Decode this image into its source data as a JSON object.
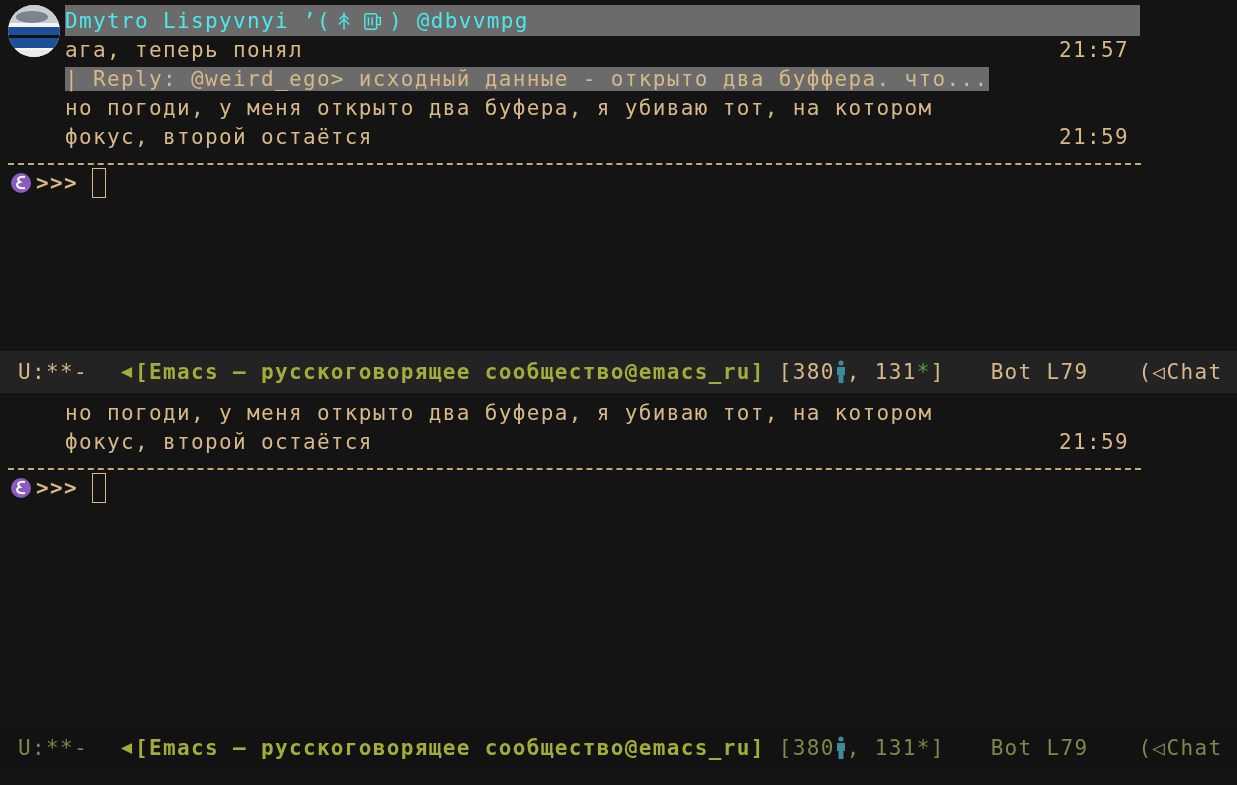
{
  "windows": [
    {
      "active": true,
      "entries": [
        {
          "kind": "author",
          "name": "Dmytro Lispyvnyi ’(",
          "handle": ") @dbvvmpg"
        },
        {
          "kind": "message",
          "lines": [
            "ага, теперь понял"
          ],
          "time": "21:57"
        },
        {
          "kind": "reply",
          "text": "| Reply: @weird_ego> исходный данные - открыто два буффера. что..."
        },
        {
          "kind": "message",
          "lines": [
            "но погоди, у меня открыто два буфера, я убиваю тот, на котором",
            "фокус, второй остаётся"
          ],
          "time": "21:59"
        }
      ],
      "prompt": ">>>",
      "mode_line": {
        "state": "U:**-",
        "buffer": "[Emacs – русскоговорящее сообщество@emacs_ru]",
        "members": "[380",
        "unread": ", 131",
        "star": "*",
        "close": "]",
        "position": "Bot L79",
        "mode": "(◁Chat"
      }
    },
    {
      "active": false,
      "entries": [
        {
          "kind": "message",
          "lines": [
            "но погоди, у меня открыто два буфера, я убиваю тот, на котором",
            "фокус, второй остаётся"
          ],
          "time": "21:59"
        }
      ],
      "prompt": ">>>",
      "mode_line": {
        "state": "U:**-",
        "buffer": "[Emacs – русскоговорящее сообщество@emacs_ru]",
        "members": "[380",
        "unread": ", 131",
        "star": "*",
        "close": "]",
        "position": "Bot L79",
        "mode": "(◁Chat"
      }
    }
  ]
}
